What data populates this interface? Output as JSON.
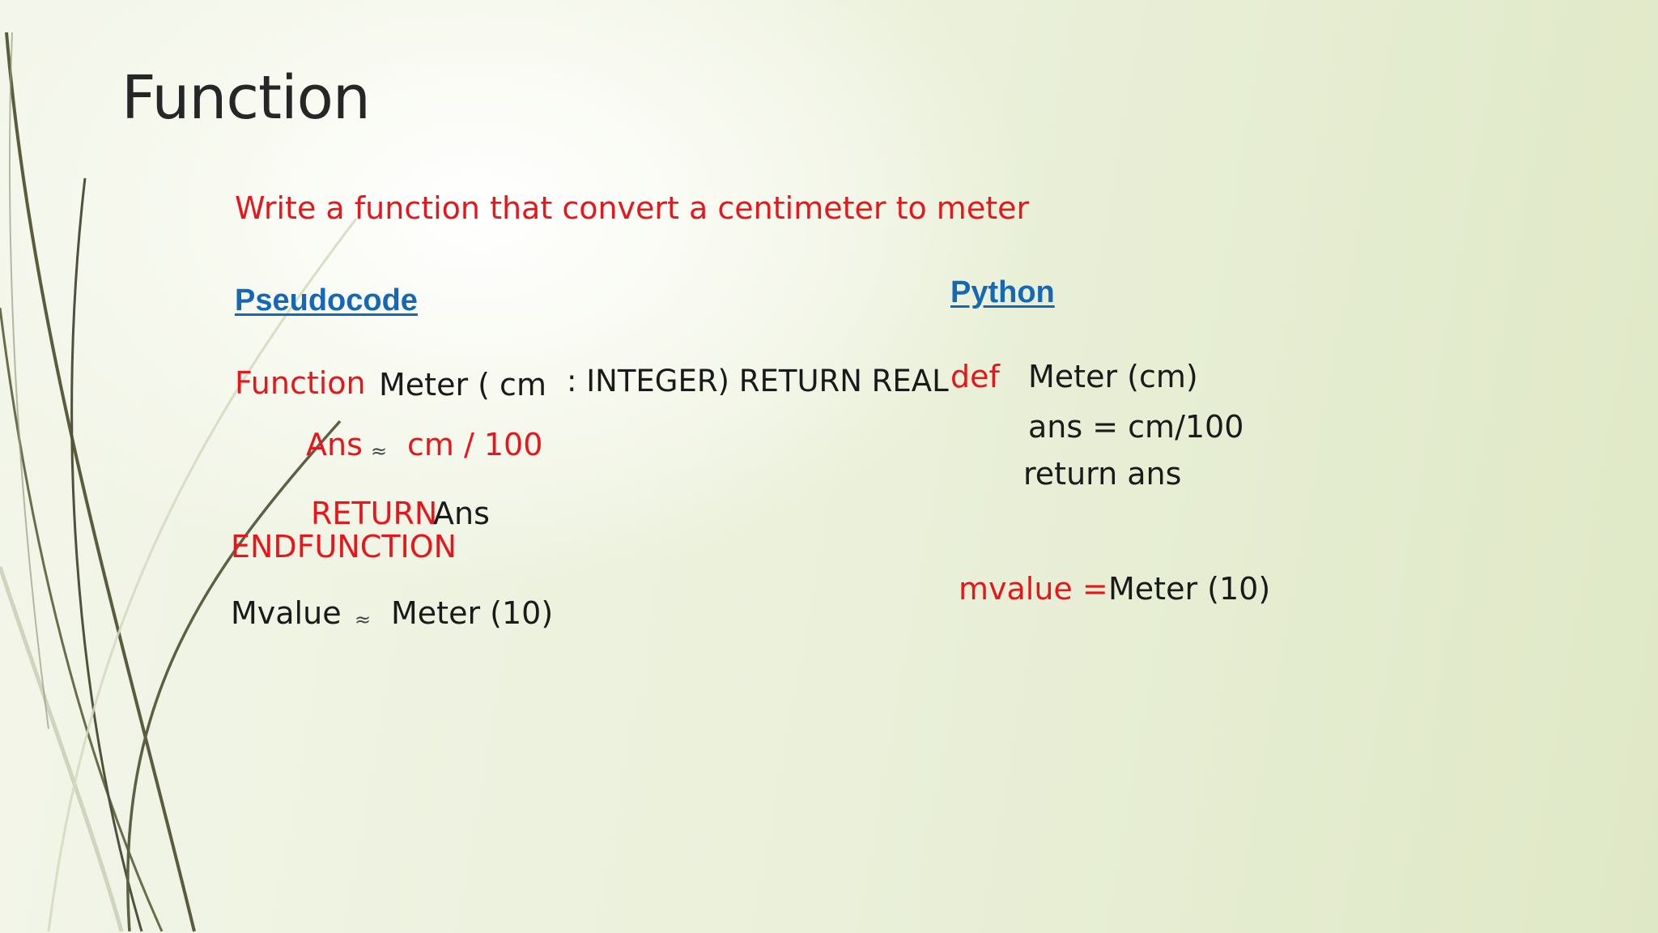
{
  "slide": {
    "title": "Function",
    "task": "Write a function that convert a centimeter to meter"
  },
  "pseudocode": {
    "heading": "Pseudocode",
    "func_keyword": "Function",
    "func_name": "Meter ( cm",
    "func_sig_rest": ": INTEGER) RETURN REAL",
    "assign_var": "Ans",
    "assign_symbol": "≈",
    "assign_expr": "cm / 100",
    "return_keyword": "RETURN",
    "return_value": "Ans",
    "end_keyword": "ENDFUNCTION",
    "call_var": "Mvalue",
    "call_symbol": "≈",
    "call_expr": "Meter (10)"
  },
  "python": {
    "heading": "Python",
    "def_keyword": "def",
    "def_sig": "Meter (cm)",
    "line_assign": "ans = cm/100",
    "line_return": "return ans",
    "call_var": "mvalue =",
    "call_expr": "Meter (10)"
  },
  "colors": {
    "keyword": "#e8161b",
    "heading_link": "#1568b4",
    "text": "#1a1a1a",
    "title": "#262626"
  }
}
